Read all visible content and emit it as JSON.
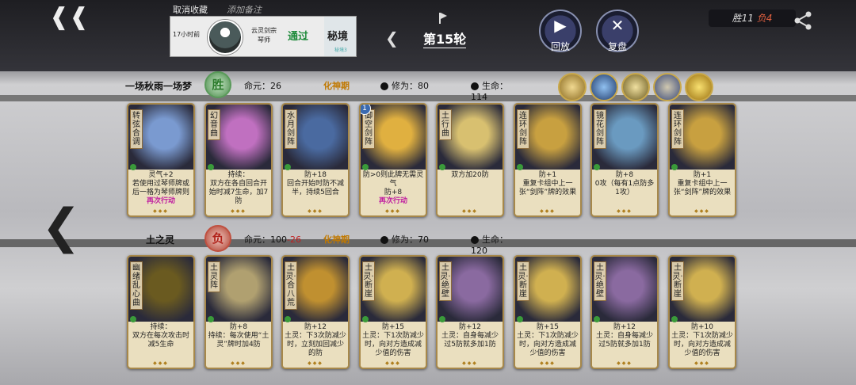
{
  "header": {
    "back_icon": "back-arrow-icon",
    "fav_label": "取消收藏",
    "note_label": "添加备注",
    "ticket": {
      "time": "17小时前",
      "sect": "云灵剑宗",
      "role": "琴师",
      "result": "通过",
      "realm": "秘境",
      "realm_sub": "秘境3"
    },
    "round_label": "第15轮",
    "replay_label": "回放",
    "review_label": "复盘",
    "score_win": "胜11",
    "score_loss": "负4"
  },
  "players": [
    {
      "name": "一场秋雨一场梦",
      "result": "胜",
      "life_label": "命元：",
      "life": "26",
      "life_delta": "",
      "stage": "化神期",
      "cultivation_label": "修为：",
      "cultivation": "80",
      "hp_label": "生命：",
      "hp": "114",
      "cards": [
        {
          "name": "转弦合调",
          "desc1": "灵气+2",
          "desc2": "若使用过琴师牌或后一格为琴师牌则",
          "desc3": "再次行动",
          "color": "#7a9ad0"
        },
        {
          "name": "幻音曲",
          "desc1": "持续：",
          "desc2": "双方在各自回合开始时减7生命，加7防",
          "desc3": "",
          "color": "#c070c0"
        },
        {
          "name": "水月剑阵",
          "desc1": "防+18",
          "desc2": "回合开始时防不减半，持续5回合",
          "desc3": "",
          "color": "#4a6aa0"
        },
        {
          "name": "御空剑阵",
          "desc1": "防>0则此牌无需灵气",
          "desc2": "防+8",
          "desc3": "再次行动",
          "color": "#e0b040",
          "level": "1"
        },
        {
          "name": "土行曲",
          "desc1": "双方加20防",
          "desc2": "",
          "desc3": "",
          "color": "#d8c070"
        },
        {
          "name": "连环剑阵",
          "desc1": "防+1",
          "desc2": "重复卡组中上一张“剑阵”牌的效果",
          "desc3": "",
          "color": "#c8a040"
        },
        {
          "name": "镜花剑阵",
          "desc1": "防+8",
          "desc2": "0攻（每有1点防多1攻）",
          "desc3": "",
          "color": "#6a9ac0"
        },
        {
          "name": "连环剑阵",
          "desc1": "防+1",
          "desc2": "重复卡组中上一张“剑阵”牌的效果",
          "desc3": "",
          "color": "#c8a040"
        }
      ]
    },
    {
      "name": "土之灵",
      "result": "负",
      "life_label": "命元：",
      "life": "100",
      "life_delta": "-26",
      "stage": "化神期",
      "cultivation_label": "修为：",
      "cultivation": "70",
      "hp_label": "生命：",
      "hp": "120",
      "cards": [
        {
          "name": "幽绪乱心曲",
          "desc1": "持续：",
          "desc2": "双方在每次攻击时减5生命",
          "desc3": "",
          "color": "#6a5a20"
        },
        {
          "name": "土灵阵",
          "desc1": "防+8",
          "desc2": "持续：每次使用“土灵”牌时加4防",
          "desc3": "",
          "color": "#b0a070"
        },
        {
          "name": "土灵·合八荒",
          "desc1": "防+12",
          "desc2": "土灵：下3次防减少时，立刻加回减少的防",
          "desc3": "",
          "color": "#c09030"
        },
        {
          "name": "土灵·断崖",
          "desc1": "防+15",
          "desc2": "土灵：下1次防减少时，向对方造成减少值的伤害",
          "desc3": "",
          "color": "#d0b050"
        },
        {
          "name": "土灵·绝壁",
          "desc1": "防+12",
          "desc2": "土灵：自身每减少过5防就多加1防",
          "desc3": "",
          "color": "#8a6aa0"
        },
        {
          "name": "土灵·断崖",
          "desc1": "防+15",
          "desc2": "土灵：下1次防减少时，向对方造成减少值的伤害",
          "desc3": "",
          "color": "#d0b050"
        },
        {
          "name": "土灵·绝壁",
          "desc1": "防+12",
          "desc2": "土灵：自身每减少过5防就多加1防",
          "desc3": "",
          "color": "#8a6aa0"
        },
        {
          "name": "土灵·断崖",
          "desc1": "防+10",
          "desc2": "土灵：下1次防减少时，向对方造成减少值的伤害",
          "desc3": "",
          "color": "#d0b050"
        }
      ]
    }
  ],
  "artifacts": [
    "talisman-icon",
    "blade-icon",
    "sword-icon",
    "figure-icon",
    "scroll-icon"
  ]
}
